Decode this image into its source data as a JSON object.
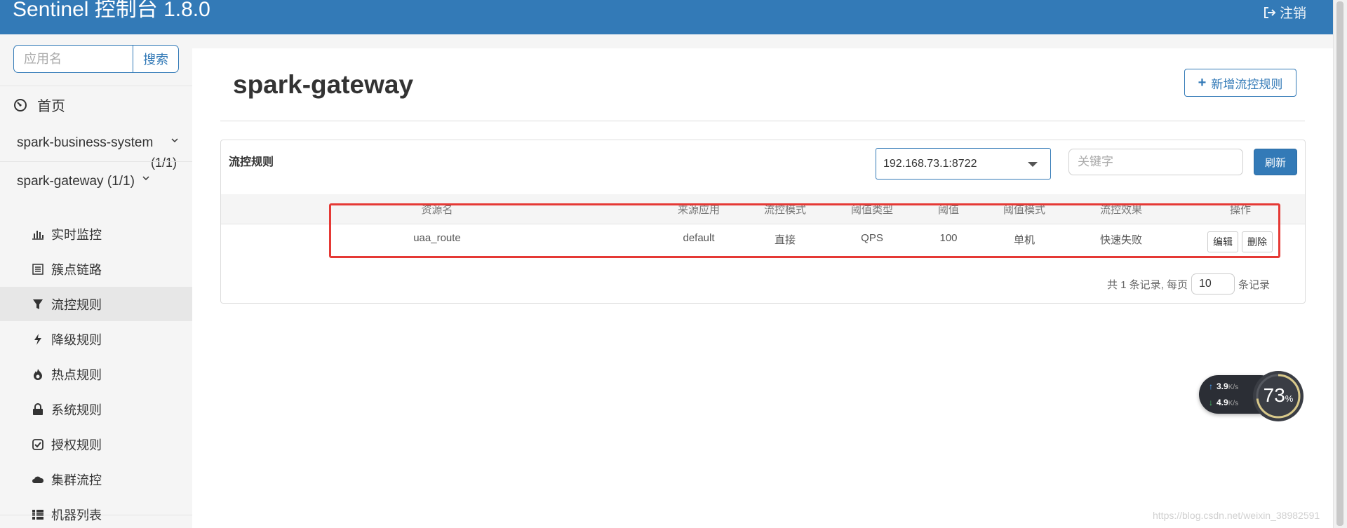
{
  "header": {
    "brand": "Sentinel 控制台 1.8.0",
    "logout_label": "注销",
    "logout_icon": "sign-out-icon",
    "color": "#337ab7"
  },
  "sidebar": {
    "search": {
      "placeholder": "应用名",
      "button": "搜索"
    },
    "home": {
      "label": "首页",
      "icon": "dashboard-icon"
    },
    "apps": [
      {
        "name": "spark-business-system",
        "count": "(1/1)"
      },
      {
        "name": "spark-gateway (1/1)"
      }
    ],
    "menu": [
      {
        "label": "实时监控",
        "icon": "bar-chart-icon"
      },
      {
        "label": "簇点链路",
        "icon": "list-icon"
      },
      {
        "label": "流控规则",
        "icon": "filter-icon",
        "active": true
      },
      {
        "label": "降级规则",
        "icon": "flash-icon"
      },
      {
        "label": "热点规则",
        "icon": "fire-icon"
      },
      {
        "label": "系统规则",
        "icon": "lock-icon"
      },
      {
        "label": "授权规则",
        "icon": "check-square-icon"
      },
      {
        "label": "集群流控",
        "icon": "cloud-icon"
      },
      {
        "label": "机器列表",
        "icon": "th-list-icon"
      }
    ]
  },
  "main": {
    "title": "spark-gateway",
    "add_button": "新增流控规则",
    "panel": {
      "title": "流控规则",
      "machine": "192.168.73.1:8722",
      "keyword_placeholder": "关键字",
      "refresh": "刷新",
      "columns": [
        "资源名",
        "来源应用",
        "流控模式",
        "阈值类型",
        "阈值",
        "阈值模式",
        "流控效果",
        "操作"
      ],
      "rows": [
        {
          "resource": "uaa_route",
          "source": "default",
          "mode": "直接",
          "grade": "QPS",
          "count": "100",
          "cluster_mode": "单机",
          "effect": "快速失败",
          "edit": "编辑",
          "delete": "删除"
        }
      ],
      "pager": {
        "prefix": "共 1 条记录, 每页",
        "page_size": "10",
        "suffix": "条记录"
      }
    }
  },
  "net_widget": {
    "up": "3.9",
    "down": "4.9",
    "unit": "K/s",
    "percent": 73,
    "pct_sign": "%"
  },
  "watermark": "https://blog.csdn.net/weixin_38982591"
}
